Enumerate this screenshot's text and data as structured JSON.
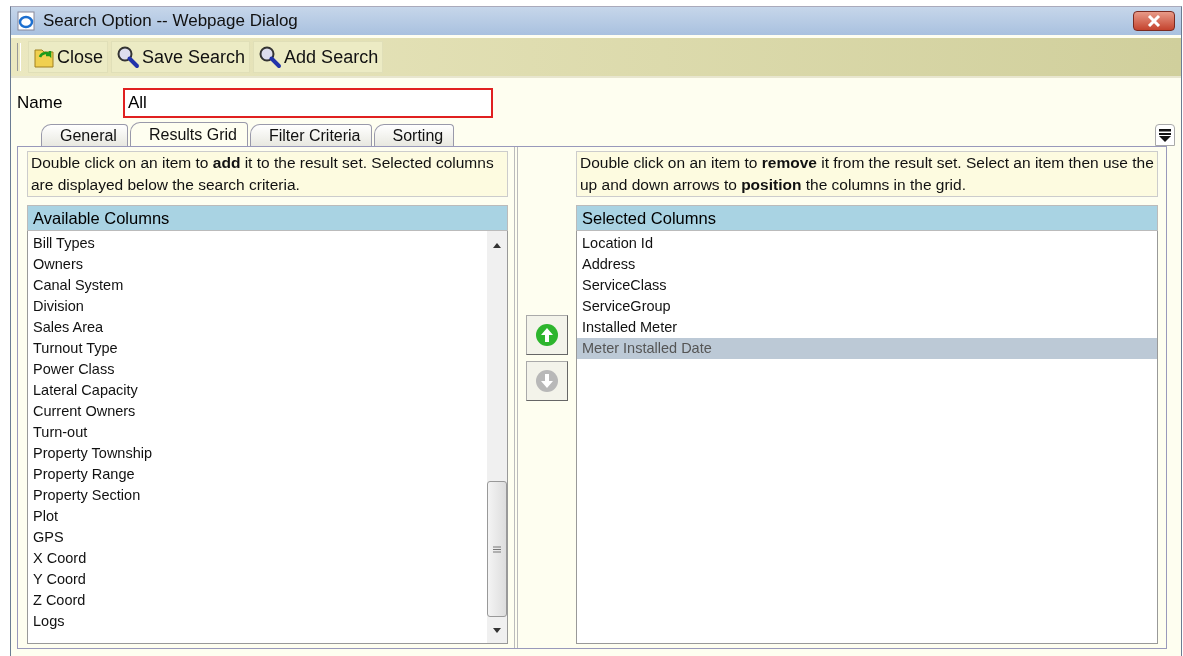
{
  "window": {
    "title": "Search Option -- Webpage Dialog"
  },
  "toolbar": [
    {
      "kind": "close",
      "label": "Close"
    },
    {
      "kind": "search",
      "label": "Save Search"
    },
    {
      "kind": "search",
      "label": "Add Search"
    }
  ],
  "name_field": {
    "label": "Name",
    "value": "All"
  },
  "tabs": [
    {
      "label": "General",
      "selected": false
    },
    {
      "label": "Results Grid",
      "selected": true
    },
    {
      "label": "Filter Criteria",
      "selected": false
    },
    {
      "label": "Sorting",
      "selected": false
    }
  ],
  "available": {
    "hint": "Double click on an item to **add** it to the result set. Selected columns are displayed below the search criteria.",
    "header": "Available Columns",
    "items": [
      "Bill Types",
      "Owners",
      "Canal System",
      "Division",
      "Sales Area",
      "Turnout Type",
      "Power Class",
      "Lateral Capacity",
      "Current Owners",
      "Turn-out",
      "Property Township",
      "Property Range",
      "Property Section",
      "Plot",
      "GPS",
      "X Coord",
      "Y Coord",
      "Z Coord",
      "Logs"
    ]
  },
  "move_buttons": [
    {
      "kind": "up",
      "disabled": false
    },
    {
      "kind": "down",
      "disabled": true
    }
  ],
  "selected": {
    "hint": "Double click on an item to **remove** it from the result set. Select an item then use the up and down arrows to **position** the columns in the grid.",
    "header": "Selected Columns",
    "items": [
      {
        "label": "Location Id",
        "selected": false
      },
      {
        "label": "Address",
        "selected": false
      },
      {
        "label": "ServiceClass",
        "selected": false
      },
      {
        "label": "ServiceGroup",
        "selected": false
      },
      {
        "label": "Installed Meter",
        "selected": false
      },
      {
        "label": "Meter Installed Date",
        "selected": true
      }
    ]
  }
}
